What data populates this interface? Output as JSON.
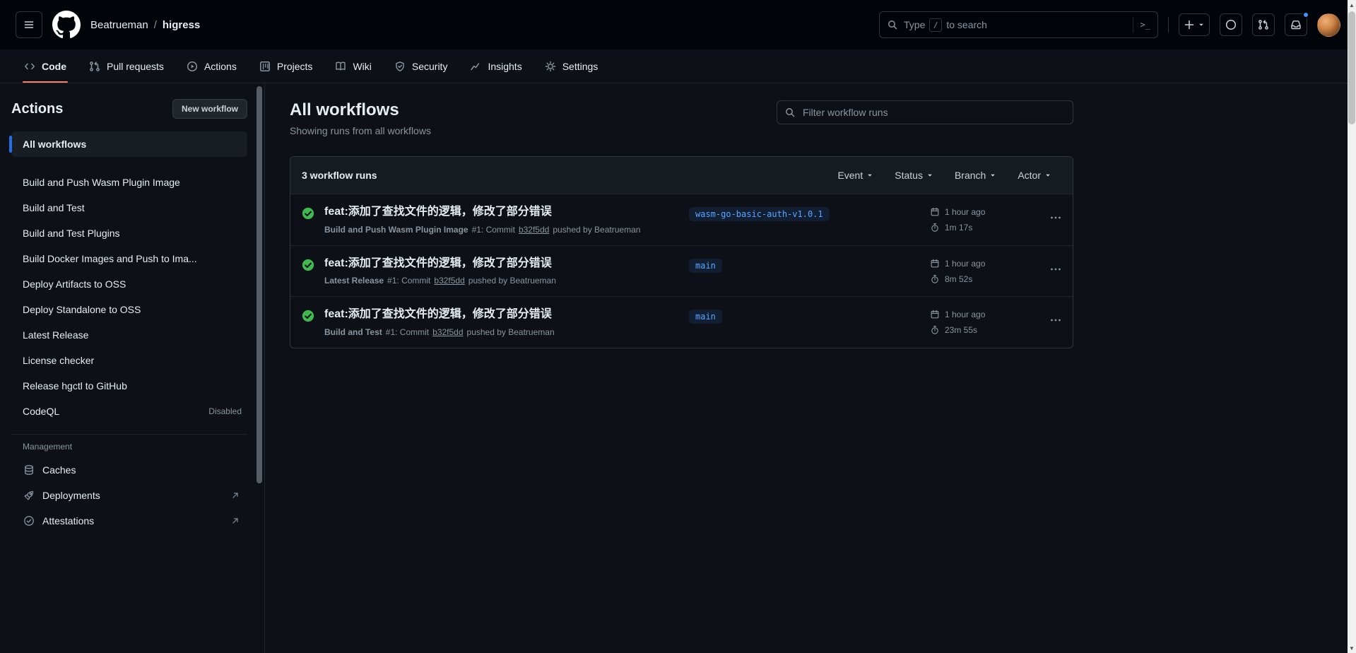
{
  "colors": {
    "accent_blue": "#4493f8",
    "success_green": "#3fb950",
    "tab_active_orange": "#f78166",
    "branch_badge_blue": "#58a6ff"
  },
  "header": {
    "owner": "Beatrueman",
    "separator": "/",
    "repo": "higress",
    "search": {
      "prefix": "Type",
      "slash_key": "/",
      "suffix": "to search",
      "command_glyph": ">_"
    }
  },
  "nav": {
    "tabs": [
      {
        "label": "Code",
        "active": true
      },
      {
        "label": "Pull requests",
        "active": false
      },
      {
        "label": "Actions",
        "active": false
      },
      {
        "label": "Projects",
        "active": false
      },
      {
        "label": "Wiki",
        "active": false
      },
      {
        "label": "Security",
        "active": false
      },
      {
        "label": "Insights",
        "active": false
      },
      {
        "label": "Settings",
        "active": false
      }
    ]
  },
  "sidebar": {
    "title": "Actions",
    "new_workflow": "New workflow",
    "selected_item": "All workflows",
    "workflows": [
      "Build and Push Wasm Plugin Image",
      "Build and Test",
      "Build and Test Plugins",
      "Build Docker Images and Push to Ima...",
      "Deploy Artifacts to OSS",
      "Deploy Standalone to OSS",
      "Latest Release",
      "License checker",
      "Release hgctl to GitHub"
    ],
    "codeql": {
      "label": "CodeQL",
      "badge": "Disabled"
    },
    "management": {
      "title": "Management",
      "items": [
        {
          "label": "Caches",
          "external": false
        },
        {
          "label": "Deployments",
          "external": true
        },
        {
          "label": "Attestations",
          "external": true
        }
      ]
    }
  },
  "main": {
    "title": "All workflows",
    "subtitle": "Showing runs from all workflows",
    "filter_placeholder": "Filter workflow runs",
    "runs_header": {
      "count": "3 workflow runs",
      "filters": [
        "Event",
        "Status",
        "Branch",
        "Actor"
      ]
    },
    "runs": [
      {
        "title": "feat:添加了查找文件的逻辑，修改了部分错误",
        "workflow": "Build and Push Wasm Plugin Image",
        "meta": "#1: Commit",
        "commit": "b32f5dd",
        "pushed": "pushed by Beatrueman",
        "branch": "wasm-go-basic-auth-v1.0.1",
        "time": "1 hour ago",
        "duration": "1m 17s"
      },
      {
        "title": "feat:添加了查找文件的逻辑，修改了部分错误",
        "workflow": "Latest Release",
        "meta": "#1: Commit",
        "commit": "b32f5dd",
        "pushed": "pushed by Beatrueman",
        "branch": "main",
        "time": "1 hour ago",
        "duration": "8m 52s"
      },
      {
        "title": "feat:添加了查找文件的逻辑，修改了部分错误",
        "workflow": "Build and Test",
        "meta": "#1: Commit",
        "commit": "b32f5dd",
        "pushed": "pushed by Beatrueman",
        "branch": "main",
        "time": "1 hour ago",
        "duration": "23m 55s"
      }
    ]
  }
}
